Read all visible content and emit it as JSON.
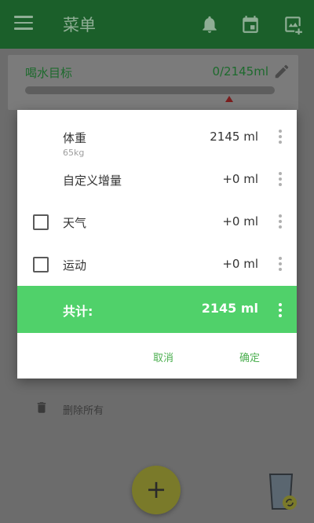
{
  "appbar": {
    "title": "菜单"
  },
  "goal": {
    "label": "喝水目标",
    "value": "0/2145ml",
    "progress": 0
  },
  "background_actions": {
    "delete_all": "删除所有"
  },
  "fab": {
    "label": "+"
  },
  "dialog": {
    "rows": [
      {
        "name": "体重",
        "sub": "65kg",
        "amount": "2145 ml",
        "checkbox": false
      },
      {
        "name": "自定义增量",
        "amount": "+0 ml",
        "checkbox": false
      },
      {
        "name": "天气",
        "amount": "+0 ml",
        "checkbox": true,
        "checked": false
      },
      {
        "name": "运动",
        "amount": "+0 ml",
        "checkbox": true,
        "checked": false
      }
    ],
    "total": {
      "label": "共计:",
      "amount": "2145 ml"
    },
    "cancel": "取消",
    "ok": "确定"
  },
  "colors": {
    "accent": "#50d16a",
    "button_text": "#4caf50",
    "appbar": "#1b5f2a"
  },
  "icons": [
    "menu-icon",
    "bell-icon",
    "calendar-icon",
    "image-add-icon",
    "edit-icon",
    "trash-icon",
    "glass-icon",
    "more-vert-icon"
  ]
}
